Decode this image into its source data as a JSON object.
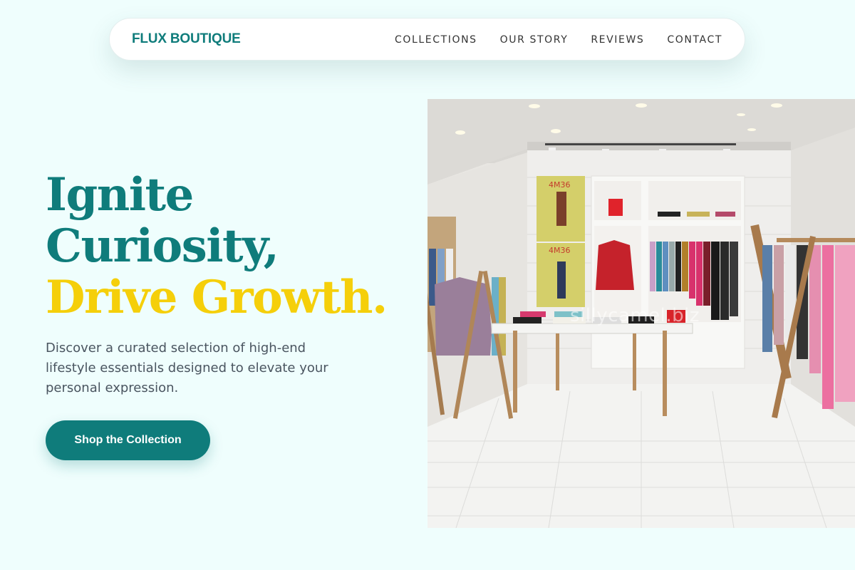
{
  "nav": {
    "brand": "FLUX BOUTIQUE",
    "items": [
      "COLLECTIONS",
      "OUR STORY",
      "REVIEWS",
      "CONTACT"
    ]
  },
  "hero": {
    "headline_line1": "Ignite",
    "headline_line2": "Curiosity,",
    "headline_line3": "Drive Growth.",
    "subtext": "Discover a curated selection of high-end lifestyle essentials designed to elevate your personal expression.",
    "cta_label": "Shop the Collection"
  },
  "image": {
    "subject": "boutique-store-interior",
    "poster_text": "4M36",
    "watermark": "sillycamel.biz"
  },
  "colors": {
    "accent": "#0f7c7b",
    "highlight": "#f5cf0a",
    "background": "#effefd"
  }
}
